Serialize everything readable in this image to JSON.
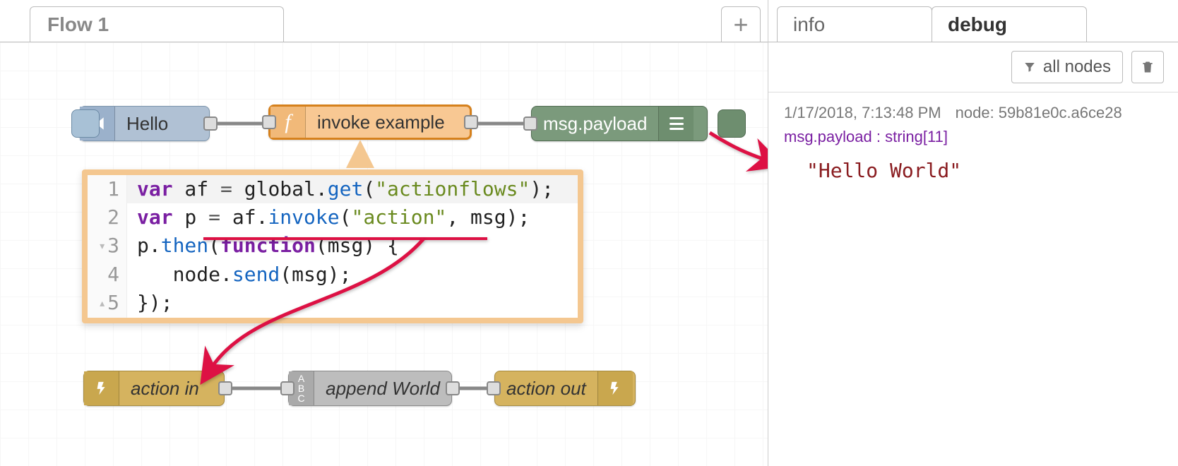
{
  "tabs": {
    "flow1": "Flow 1"
  },
  "nodes": {
    "inject": {
      "label": "Hello"
    },
    "func": {
      "label": "invoke example"
    },
    "debug": {
      "label": "msg.payload"
    },
    "actionIn": {
      "label": "action in"
    },
    "change": {
      "label": "append World"
    },
    "actionOut": {
      "label": "action out"
    }
  },
  "code": {
    "l1a": "var",
    "l1b": " af ",
    "l1c": "=",
    "l1d": " global.",
    "l1e": "get",
    "l1f": "(",
    "l1g": "\"actionflows\"",
    "l1h": ");",
    "l2a": "var",
    "l2b": " p ",
    "l2c": "=",
    "l2d": " af.",
    "l2e": "invoke",
    "l2f": "(",
    "l2g": "\"action\"",
    "l2h": ", msg);",
    "l3a": "p.",
    "l3b": "then",
    "l3c": "(",
    "l3d": "function",
    "l3e": "(msg) {",
    "l4": "   node.",
    "l4b": "send",
    "l4c": "(msg);",
    "l5": "});",
    "n1": "1",
    "n2": "2",
    "n3": "3",
    "n4": "4",
    "n5": "5"
  },
  "sidebar": {
    "tabs": {
      "info": "info",
      "debug": "debug"
    },
    "filter": "all nodes",
    "entry": {
      "time": "1/17/2018, 7:13:48 PM",
      "node": "node: 59b81e0c.a6ce28",
      "type": "msg.payload : string[11]",
      "value": "\"Hello World\""
    }
  }
}
